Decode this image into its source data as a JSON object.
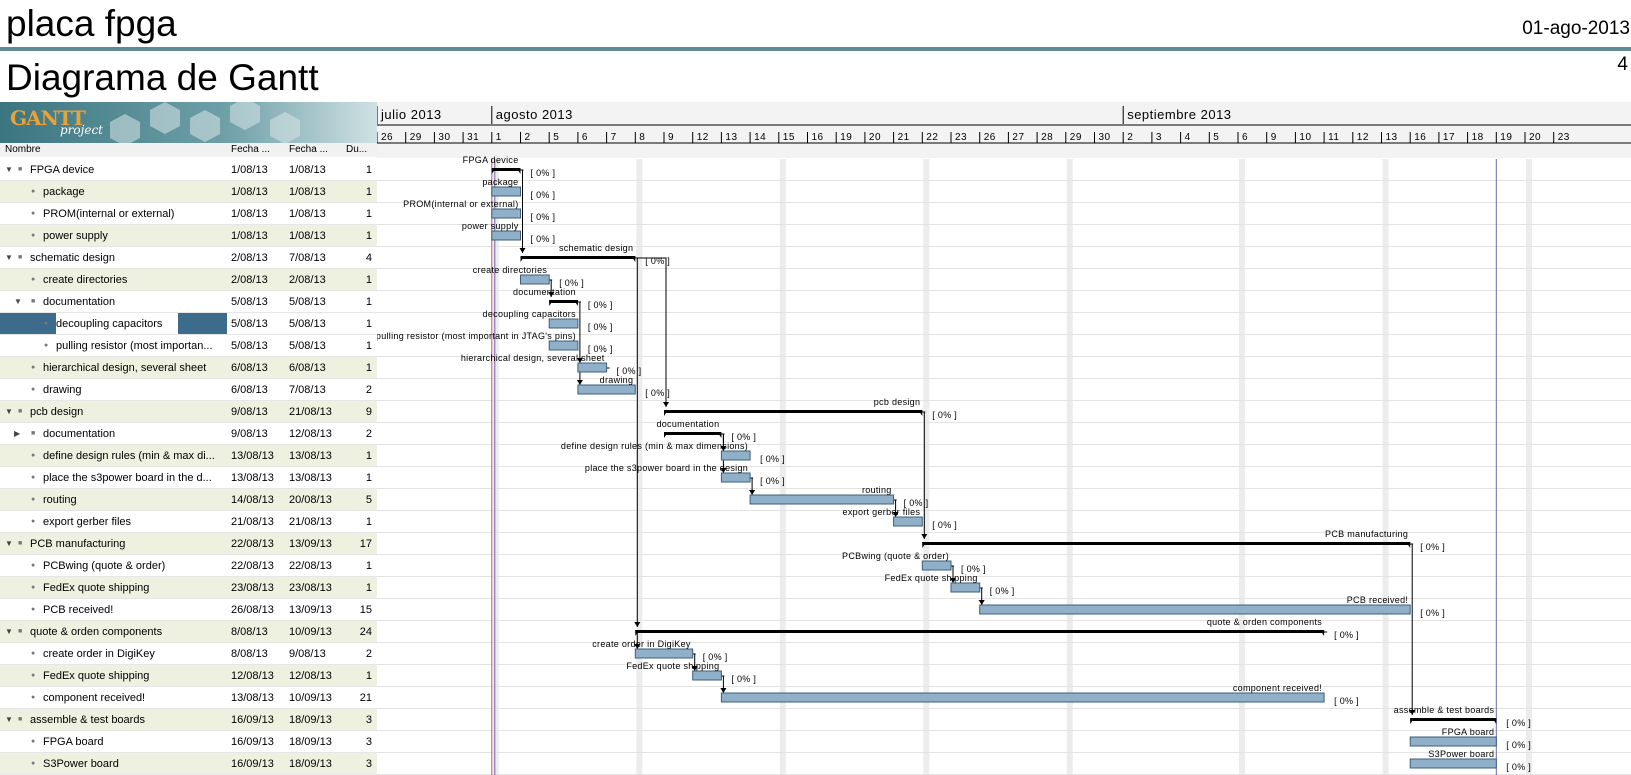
{
  "document": {
    "project": "placa fpga",
    "date": "01-ago-2013",
    "chart_title": "Diagrama de Gantt",
    "page_number": "4"
  },
  "logo": {
    "text": "GANTT",
    "sub": "project"
  },
  "columns": {
    "name": "Nombre",
    "start": "Fecha ...",
    "end": "Fecha ...",
    "duration": "Du..."
  },
  "months": [
    "julio 2013",
    "agosto 2013",
    "septiembre 2013"
  ],
  "days": [
    "26",
    "29",
    "30",
    "31",
    "1",
    "2",
    "5",
    "6",
    "7",
    "8",
    "9",
    "12",
    "13",
    "14",
    "15",
    "16",
    "19",
    "20",
    "21",
    "22",
    "23",
    "26",
    "27",
    "28",
    "29",
    "30",
    "2",
    "3",
    "4",
    "5",
    "6",
    "9",
    "10",
    "11",
    "12",
    "13",
    "16",
    "17",
    "18",
    "19",
    "20",
    "23"
  ],
  "progress_label": "[ 0% ]",
  "colors": {
    "bar": "#8fb0c8",
    "bar_border": "#3d5f7a",
    "header_rule": "#5e8a91",
    "selection": "#3d6b8c",
    "today_line": "#d24a6e",
    "row_alt": "#eef0e0"
  },
  "tasks": [
    {
      "id": 0,
      "name": "FPGA device",
      "start": "1/08/13",
      "end": "1/08/13",
      "duration": "1",
      "level": 0,
      "expander": "open",
      "summary": true,
      "gs": 4,
      "ge": 5
    },
    {
      "id": 1,
      "name": "package",
      "start": "1/08/13",
      "end": "1/08/13",
      "duration": "1",
      "level": 1,
      "gs": 4,
      "ge": 5
    },
    {
      "id": 2,
      "name": "PROM(internal or external)",
      "start": "1/08/13",
      "end": "1/08/13",
      "duration": "1",
      "level": 1,
      "gs": 4,
      "ge": 5
    },
    {
      "id": 3,
      "name": "power supply",
      "start": "1/08/13",
      "end": "1/08/13",
      "duration": "1",
      "level": 1,
      "gs": 4,
      "ge": 5
    },
    {
      "id": 4,
      "name": "schematic design",
      "start": "2/08/13",
      "end": "7/08/13",
      "duration": "4",
      "level": 0,
      "expander": "open",
      "summary": true,
      "gs": 5,
      "ge": 9
    },
    {
      "id": 5,
      "name": "create directories",
      "start": "2/08/13",
      "end": "2/08/13",
      "duration": "1",
      "level": 1,
      "gs": 5,
      "ge": 6
    },
    {
      "id": 6,
      "name": "documentation",
      "start": "5/08/13",
      "end": "5/08/13",
      "duration": "1",
      "level": 1,
      "expander": "open",
      "summary": true,
      "gs": 6,
      "ge": 7
    },
    {
      "id": 7,
      "name": "decoupling capacitors",
      "start": "5/08/13",
      "end": "5/08/13",
      "duration": "1",
      "level": 2,
      "selected": true,
      "gs": 6,
      "ge": 7
    },
    {
      "id": 8,
      "name": "pulling resistor (most importan...",
      "chart_label": "pulling resistor (most important in JTAG's pins)",
      "start": "5/08/13",
      "end": "5/08/13",
      "duration": "1",
      "level": 2,
      "gs": 6,
      "ge": 7
    },
    {
      "id": 9,
      "name": "hierarchical design, several sheet",
      "start": "6/08/13",
      "end": "6/08/13",
      "duration": "1",
      "level": 1,
      "gs": 7,
      "ge": 8
    },
    {
      "id": 10,
      "name": "drawing",
      "start": "6/08/13",
      "end": "7/08/13",
      "duration": "2",
      "level": 1,
      "gs": 7,
      "ge": 9
    },
    {
      "id": 11,
      "name": "pcb design",
      "start": "9/08/13",
      "end": "21/08/13",
      "duration": "9",
      "level": 0,
      "expander": "open",
      "summary": true,
      "gs": 10,
      "ge": 19
    },
    {
      "id": 12,
      "name": "documentation",
      "start": "9/08/13",
      "end": "12/08/13",
      "duration": "2",
      "level": 1,
      "expander": "closed",
      "summary": true,
      "gs": 10,
      "ge": 12
    },
    {
      "id": 13,
      "name": "define design rules (min & max di...",
      "chart_label": "define design rules (min & max dimensions)",
      "start": "13/08/13",
      "end": "13/08/13",
      "duration": "1",
      "level": 1,
      "gs": 12,
      "ge": 13
    },
    {
      "id": 14,
      "name": "place the s3power board in the d...",
      "chart_label": "place the s3power board in the design",
      "start": "13/08/13",
      "end": "13/08/13",
      "duration": "1",
      "level": 1,
      "gs": 12,
      "ge": 13
    },
    {
      "id": 15,
      "name": "routing",
      "start": "14/08/13",
      "end": "20/08/13",
      "duration": "5",
      "level": 1,
      "gs": 13,
      "ge": 18
    },
    {
      "id": 16,
      "name": "export gerber files",
      "start": "21/08/13",
      "end": "21/08/13",
      "duration": "1",
      "level": 1,
      "gs": 18,
      "ge": 19
    },
    {
      "id": 17,
      "name": "PCB manufacturing",
      "start": "22/08/13",
      "end": "13/09/13",
      "duration": "17",
      "level": 0,
      "expander": "open",
      "summary": true,
      "gs": 19,
      "ge": 36
    },
    {
      "id": 18,
      "name": "PCBwing (quote & order)",
      "start": "22/08/13",
      "end": "22/08/13",
      "duration": "1",
      "level": 1,
      "gs": 19,
      "ge": 20
    },
    {
      "id": 19,
      "name": "FedEx quote shipping",
      "start": "23/08/13",
      "end": "23/08/13",
      "duration": "1",
      "level": 1,
      "gs": 20,
      "ge": 21
    },
    {
      "id": 20,
      "name": "PCB received!",
      "start": "26/08/13",
      "end": "13/09/13",
      "duration": "15",
      "level": 1,
      "gs": 21,
      "ge": 36
    },
    {
      "id": 21,
      "name": "quote & orden components",
      "start": "8/08/13",
      "end": "10/09/13",
      "duration": "24",
      "level": 0,
      "expander": "open",
      "summary": true,
      "gs": 9,
      "ge": 33
    },
    {
      "id": 22,
      "name": "create order in DigiKey",
      "start": "8/08/13",
      "end": "9/08/13",
      "duration": "2",
      "level": 1,
      "gs": 9,
      "ge": 11
    },
    {
      "id": 23,
      "name": "FedEx quote shipping",
      "start": "12/08/13",
      "end": "12/08/13",
      "duration": "1",
      "level": 1,
      "gs": 11,
      "ge": 12
    },
    {
      "id": 24,
      "name": "component received!",
      "start": "13/08/13",
      "end": "10/09/13",
      "duration": "21",
      "level": 1,
      "gs": 12,
      "ge": 33
    },
    {
      "id": 25,
      "name": "assemble & test boards",
      "start": "16/09/13",
      "end": "18/09/13",
      "duration": "3",
      "level": 0,
      "expander": "open",
      "summary": true,
      "gs": 36,
      "ge": 39
    },
    {
      "id": 26,
      "name": "FPGA board",
      "start": "16/09/13",
      "end": "18/09/13",
      "duration": "3",
      "level": 1,
      "gs": 36,
      "ge": 39
    },
    {
      "id": 27,
      "name": "S3Power board",
      "start": "16/09/13",
      "end": "18/09/13",
      "duration": "3",
      "level": 1,
      "gs": 36,
      "ge": 39
    }
  ],
  "dependencies": [
    [
      0,
      4
    ],
    [
      5,
      6
    ],
    [
      6,
      9
    ],
    [
      9,
      10
    ],
    [
      4,
      11
    ],
    [
      4,
      21
    ],
    [
      12,
      13
    ],
    [
      12,
      14
    ],
    [
      14,
      15
    ],
    [
      15,
      16
    ],
    [
      11,
      17
    ],
    [
      18,
      19
    ],
    [
      19,
      20
    ],
    [
      22,
      23
    ],
    [
      23,
      24
    ],
    [
      17,
      25
    ],
    [
      21,
      22
    ]
  ]
}
